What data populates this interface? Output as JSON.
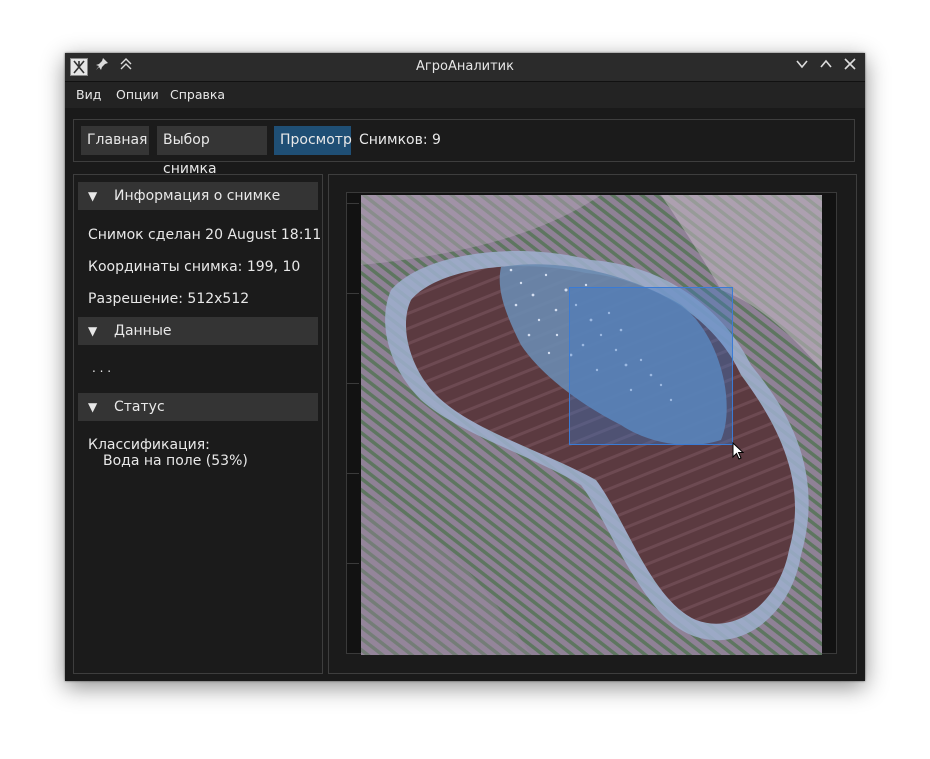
{
  "window": {
    "title": "АгроАналитик"
  },
  "titlebar": {
    "icons": [
      "app-icon",
      "pin-icon",
      "keep-above-icon",
      "minimize-icon",
      "maximize-icon",
      "close-icon"
    ]
  },
  "menu": {
    "items": [
      "Вид",
      "Опции",
      "Справка"
    ]
  },
  "toolbar": {
    "tabs": [
      "Главная",
      "Выбор снимка",
      "Просмотр"
    ],
    "active_tab": "Просмотр",
    "count_label": "Снимков: 9"
  },
  "sidebar": {
    "sections": [
      {
        "title": "Информация о снимке",
        "lines": [
          "Снимок сделан 20 August 18:11",
          "Координаты снимка: 199, 10",
          "Разрешение: 512x512"
        ]
      },
      {
        "title": "Данные",
        "lines": [
          ". . ."
        ]
      },
      {
        "title": "Статус",
        "lines": [
          "Классификация:",
          "Вода на поле (53%)"
        ]
      }
    ]
  },
  "colors": {
    "accent": "#1f4f75",
    "selection": "#3a7bd5",
    "background": "#1a1a1a"
  }
}
